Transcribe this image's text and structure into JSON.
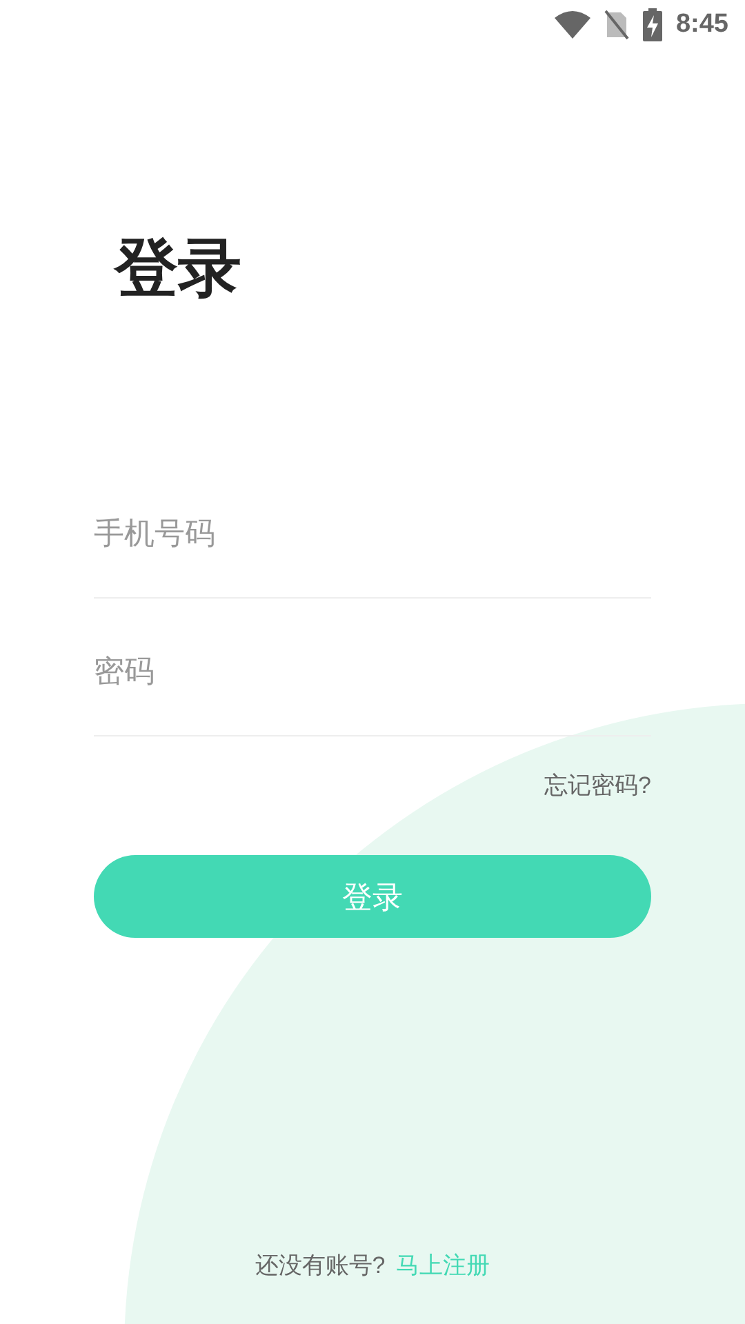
{
  "status_bar": {
    "time": "8:45"
  },
  "title": "登录",
  "fields": [
    {
      "placeholder": "手机号码"
    },
    {
      "placeholder": "密码"
    }
  ],
  "forgot_link": "忘记密码?",
  "login_button": "登录",
  "footer": {
    "prompt": "还没有账号?",
    "link": "马上注册"
  }
}
